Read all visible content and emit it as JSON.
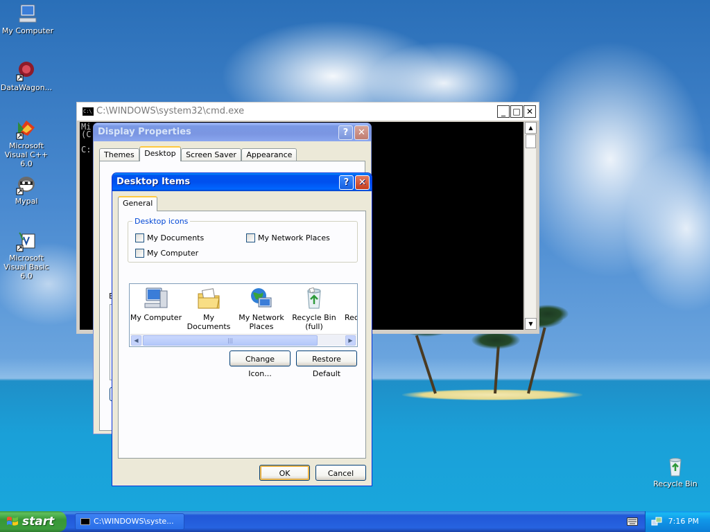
{
  "desktop": {
    "icons": [
      {
        "label": "My Computer",
        "icon": "my-computer-icon"
      },
      {
        "label": "DataWagon...",
        "icon": "datawagon-icon"
      },
      {
        "label": "Microsoft Visual C++ 6.0",
        "icon": "visual-cpp-icon"
      },
      {
        "label": "Mypal",
        "icon": "mypal-icon"
      },
      {
        "label": "Microsoft Visual Basic 6.0",
        "icon": "visual-basic-icon"
      },
      {
        "label": "Recycle Bin",
        "icon": "recycle-bin-icon"
      }
    ]
  },
  "cmd_window": {
    "title": "C:\\WINDOWS\\system32\\cmd.exe",
    "console_lines": [
      "Mi",
      "(C",
      "",
      "C:"
    ],
    "buttons": {
      "minimize": "_",
      "maximize": "□",
      "close": "✕"
    }
  },
  "display_properties": {
    "title": "Display Properties",
    "help_label": "?",
    "close_label": "✕",
    "tabs": [
      "Themes",
      "Desktop",
      "Screen Saver",
      "Appearance"
    ],
    "active_tab": "Desktop",
    "partial_label": "B"
  },
  "desktop_items": {
    "title": "Desktop Items",
    "help_label": "?",
    "close_label": "✕",
    "tab": "General",
    "group_label": "Desktop icons",
    "checkboxes": [
      {
        "label": "My Documents",
        "checked": false
      },
      {
        "label": "My Network Places",
        "checked": false
      },
      {
        "label": "My Computer",
        "checked": false
      }
    ],
    "icon_list": [
      {
        "label": "My Computer",
        "icon": "my-computer-icon"
      },
      {
        "label": "My Documents",
        "icon": "my-documents-icon"
      },
      {
        "label": "My Network Places",
        "icon": "network-places-icon"
      },
      {
        "label": "Recycle Bin (full)",
        "icon": "recycle-bin-full-icon"
      },
      {
        "label": "Rec (",
        "icon": "recycle-bin-icon"
      }
    ],
    "change_icon_label": "Change Icon...",
    "restore_default_label": "Restore Default",
    "ok_label": "OK",
    "cancel_label": "Cancel"
  },
  "taskbar": {
    "start_label": "start",
    "task_label": "C:\\WINDOWS\\syste...",
    "clock": "7:16 PM"
  },
  "colors": {
    "xp_blue": "#0054e3",
    "start_green": "#3c9b3c",
    "dialog_face": "#ece9d8",
    "group_label": "#0046d5"
  }
}
